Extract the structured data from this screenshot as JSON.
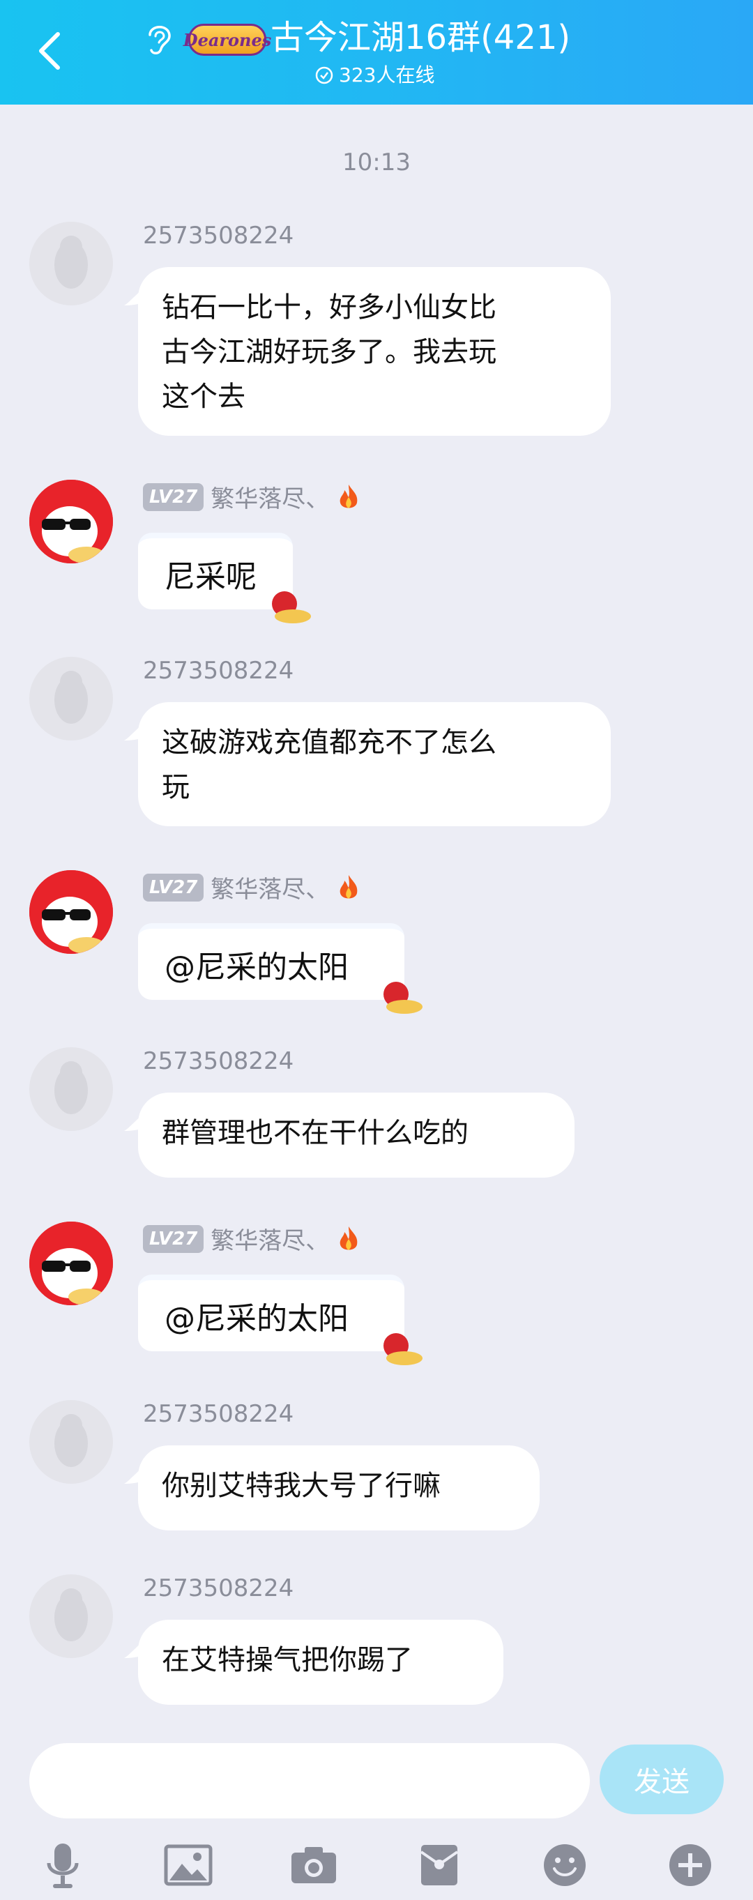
{
  "header": {
    "title": "古今江湖16群(421)",
    "subtitle": "323人在线",
    "badge": "Dearones",
    "gradient_start": "#19c3f1",
    "gradient_end": "#2aa8f6"
  },
  "chat": {
    "timestamp": "10:13",
    "messages": [
      {
        "sender": "2573508224",
        "text_lines": [
          "钻石一比十，好多小仙女比",
          "古今江湖好玩多了。我去玩",
          "这个去"
        ]
      },
      {
        "sender": "繁华落尽、",
        "level": "LV27",
        "text_lines": [
          "尼采呢"
        ]
      },
      {
        "sender": "2573508224",
        "text_lines": [
          "这破游戏充值都充不了怎么",
          "玩"
        ]
      },
      {
        "sender": "繁华落尽、",
        "level": "LV27",
        "text_lines": [
          "@尼采的太阳"
        ]
      },
      {
        "sender": "2573508224",
        "text_lines": [
          "群管理也不在干什么吃的"
        ]
      },
      {
        "sender": "繁华落尽、",
        "level": "LV27",
        "text_lines": [
          "@尼采的太阳"
        ]
      },
      {
        "sender": "2573508224",
        "text_lines": [
          "你别艾特我大号了行嘛"
        ]
      },
      {
        "sender": "2573508224",
        "text_lines": [
          "在艾特操气把你踢了"
        ]
      }
    ]
  },
  "composer": {
    "send_label": "发送",
    "tools": [
      "microphone-icon",
      "image-icon",
      "camera-icon",
      "red-packet-icon",
      "emoji-icon",
      "plus-icon"
    ]
  },
  "colors": {
    "background": "#ecedf5",
    "send_disabled": "#a9e4f7",
    "level_badge": "#b7bac6"
  }
}
